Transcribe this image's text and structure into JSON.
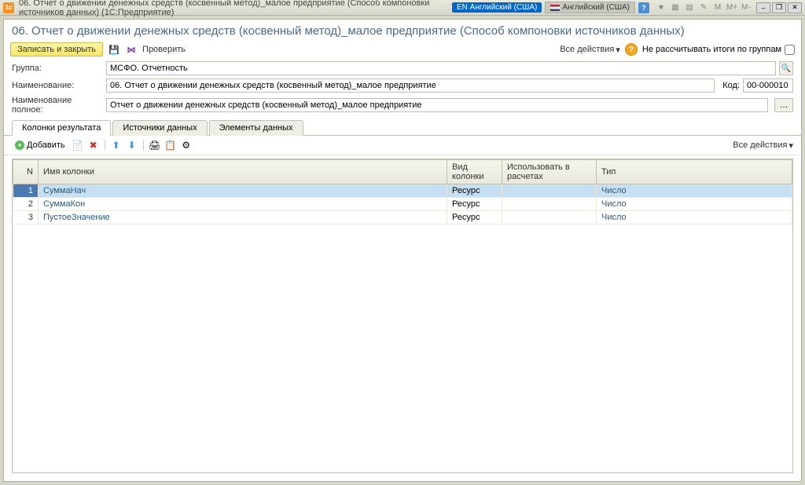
{
  "titlebar": {
    "title": "06. Отчет о движении денежных средств (косвенный метод)_малое предприятие (Способ компоновки источников данных)  (1С:Предприятие)",
    "lang1": "EN Английский (США)",
    "lang2": "Английский (США)",
    "m_labels": [
      "M",
      "M+",
      "M-"
    ]
  },
  "page": {
    "title": "06. Отчет о движении денежных средств (косвенный метод)_малое предприятие (Способ компоновки источников данных)"
  },
  "toolbar": {
    "save_close": "Записать и закрыть",
    "check": "Проверить",
    "all_actions": "Все действия",
    "no_group_totals": "Не рассчитывать итоги по группам"
  },
  "form": {
    "group_label": "Группа:",
    "group_value": "МСФО. Отчетность",
    "name_label": "Наименование:",
    "name_value": "06. Отчет о движении денежных средств (косвенный метод)_малое предприятие",
    "code_label": "Код:",
    "code_value": "00-000010",
    "fullname_label": "Наименование полное:",
    "fullname_value": "Отчет о движении денежных средств (косвенный метод)_малое предприятие"
  },
  "tabs": {
    "t1": "Колонки результата",
    "t2": "Источники данных",
    "t3": "Элементы данных"
  },
  "subtoolbar": {
    "add": "Добавить",
    "all_actions": "Все действия"
  },
  "table": {
    "headers": {
      "n": "N",
      "name": "Имя колонки",
      "kind": "Вид колонки",
      "use": "Использовать в расчетах",
      "type": "Тип"
    },
    "rows": [
      {
        "n": "1",
        "name": "СуммаНач",
        "kind": "Ресурс",
        "use": "",
        "type": "Число"
      },
      {
        "n": "2",
        "name": "СуммаКон",
        "kind": "Ресурс",
        "use": "",
        "type": "Число"
      },
      {
        "n": "3",
        "name": "ПустоеЗначение",
        "kind": "Ресурс",
        "use": "",
        "type": "Число"
      }
    ]
  }
}
